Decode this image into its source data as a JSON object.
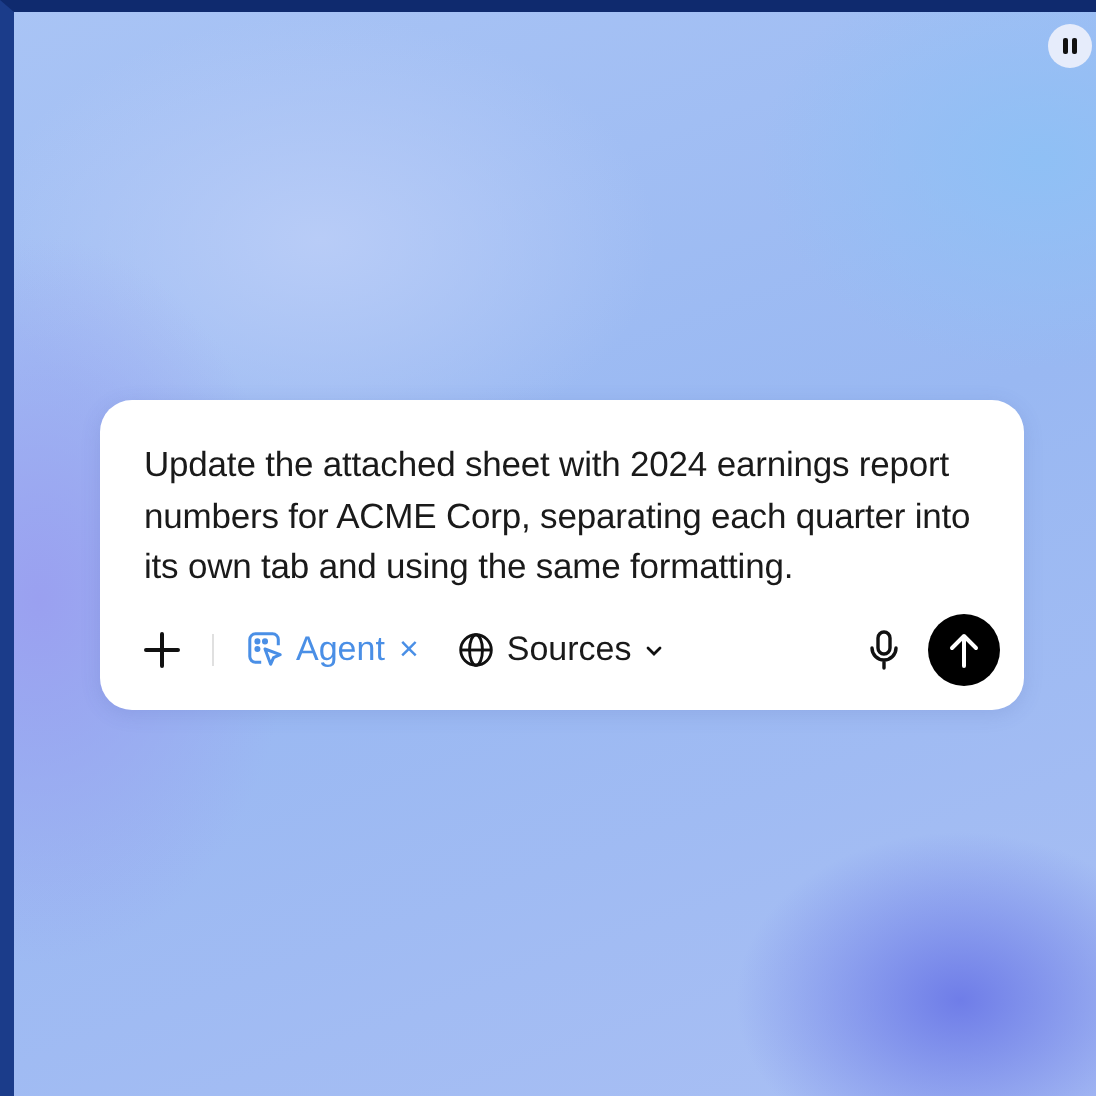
{
  "prompt": {
    "text": "Update the attached sheet with 2024 earnings report numbers for ACME Corp, separating each quarter into its own tab and using the same formatting."
  },
  "agent_chip": {
    "label": "Agent",
    "remove": "×"
  },
  "sources": {
    "label": "Sources"
  }
}
